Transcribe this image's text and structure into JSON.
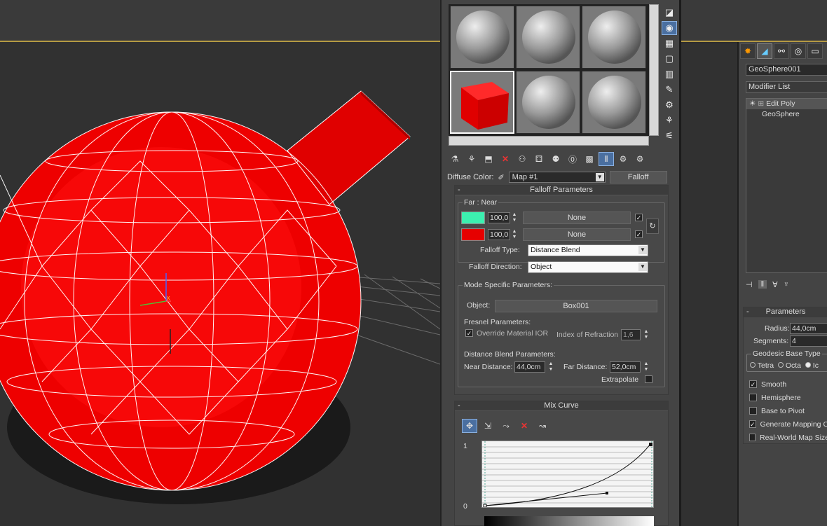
{
  "material_editor": {
    "diffuse_label": "Diffuse Color:",
    "map_name": "Map #1",
    "map_type": "Falloff",
    "falloff_params": {
      "title": "Falloff Parameters",
      "far_near_label": "Far : Near",
      "rows": [
        {
          "color": "#3cf0b0",
          "value": "100,0",
          "map": "None",
          "checked": true
        },
        {
          "color": "#e60000",
          "value": "100,0",
          "map": "None",
          "checked": true
        }
      ],
      "falloff_type_label": "Falloff Type:",
      "falloff_type_value": "Distance Blend",
      "falloff_direction_label": "Falloff Direction:",
      "falloff_direction_value": "Object"
    },
    "mode_specific": {
      "title": "Mode Specific Parameters:",
      "object_label": "Object:",
      "object_value": "Box001",
      "fresnel_title": "Fresnel Parameters:",
      "override_label": "Override Material IOR",
      "ior_label": "Index of Refraction",
      "ior_value": "1,6",
      "distance_title": "Distance Blend Parameters:",
      "near_label": "Near Distance:",
      "near_value": "44,0cm",
      "far_label": "Far Distance:",
      "far_value": "52,0cm",
      "extrapolate_label": "Extrapolate"
    },
    "mix_curve": {
      "title": "Mix Curve",
      "y_top": "1",
      "y_bottom": "0"
    },
    "colors": {
      "accent_near": "#3cf0b0",
      "accent_far": "#e60000"
    }
  },
  "command_panel": {
    "object_name": "GeoSphere001",
    "modifier_list": "Modifier List",
    "stack": [
      "Edit Poly",
      "GeoSphere"
    ],
    "parameters": {
      "title": "Parameters",
      "radius_label": "Radius:",
      "radius_value": "44,0cm",
      "segments_label": "Segments:",
      "segments_value": "4",
      "base_type_title": "Geodesic Base Type",
      "base_types": [
        "Tetra",
        "Octa",
        "Ic"
      ],
      "checkboxes": [
        {
          "label": "Smooth",
          "checked": true
        },
        {
          "label": "Hemisphere",
          "checked": false
        },
        {
          "label": "Base to Pivot",
          "checked": false
        },
        {
          "label": "Generate Mapping Co",
          "checked": true
        },
        {
          "label": "Real-World Map Size",
          "checked": false
        }
      ]
    }
  }
}
